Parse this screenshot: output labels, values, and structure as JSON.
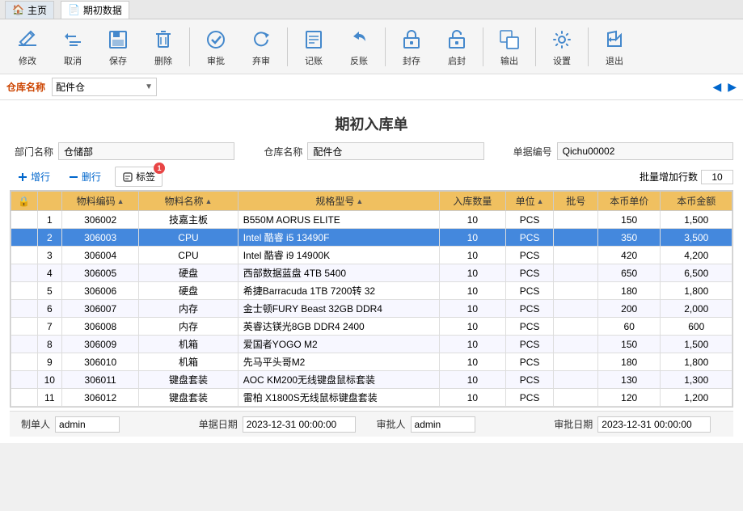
{
  "titleBar": {
    "homeTab": "主页",
    "activeTab": "期初数据"
  },
  "toolbar": {
    "buttons": [
      {
        "id": "edit",
        "label": "修改",
        "icon": "✏️"
      },
      {
        "id": "cancel",
        "label": "取消",
        "icon": "↩️"
      },
      {
        "id": "save",
        "label": "保存",
        "icon": "💾"
      },
      {
        "id": "delete",
        "label": "删除",
        "icon": "🗑️"
      },
      {
        "id": "approve",
        "label": "审批",
        "icon": "✅"
      },
      {
        "id": "abandon",
        "label": "弃审",
        "icon": "🔙"
      },
      {
        "id": "account",
        "label": "记账",
        "icon": "📒"
      },
      {
        "id": "reversal",
        "label": "反账",
        "icon": "🔄"
      },
      {
        "id": "seal",
        "label": "封存",
        "icon": "📦"
      },
      {
        "id": "unseal",
        "label": "启封",
        "icon": "📬"
      },
      {
        "id": "export",
        "label": "输出",
        "icon": "📤"
      },
      {
        "id": "settings",
        "label": "设置",
        "icon": "⚙️"
      },
      {
        "id": "exit",
        "label": "退出",
        "icon": "🚪"
      }
    ]
  },
  "warehouseBar": {
    "label": "仓库名称",
    "value": "配件仓"
  },
  "pageTitle": "期初入库单",
  "formFields": {
    "deptLabel": "部门名称",
    "deptValue": "仓储部",
    "warehouseLabel": "仓库名称",
    "warehouseValue": "配件仓",
    "docLabel": "单据编号",
    "docValue": "Qichu00002"
  },
  "actionBar": {
    "addLabel": "增行",
    "deleteLabel": "删行",
    "tagLabel": "标签",
    "tagBadge": "1",
    "batchLabel": "批量增加行数",
    "batchValue": "10"
  },
  "tableHeaders": [
    {
      "id": "lock",
      "label": ""
    },
    {
      "id": "num",
      "label": ""
    },
    {
      "id": "code",
      "label": "物料编码"
    },
    {
      "id": "name",
      "label": "物料名称"
    },
    {
      "id": "spec",
      "label": "规格型号"
    },
    {
      "id": "qty",
      "label": "入库数量"
    },
    {
      "id": "unit",
      "label": "单位"
    },
    {
      "id": "batch",
      "label": "批号"
    },
    {
      "id": "price",
      "label": "本币单价"
    },
    {
      "id": "amount",
      "label": "本币金额"
    }
  ],
  "tableRows": [
    {
      "num": 1,
      "code": "306002",
      "name": "技嘉主板",
      "spec": "B550M AORUS ELITE",
      "qty": 10,
      "unit": "PCS",
      "batch": "",
      "price": 150,
      "amount": "1,500",
      "selected": false
    },
    {
      "num": 2,
      "code": "306003",
      "name": "CPU",
      "spec": "Intel 酷睿 i5 13490F",
      "qty": 10,
      "unit": "PCS",
      "batch": "",
      "price": 350,
      "amount": "3,500",
      "selected": true
    },
    {
      "num": 3,
      "code": "306004",
      "name": "CPU",
      "spec": "Intel 酷睿 i9 14900K",
      "qty": 10,
      "unit": "PCS",
      "batch": "",
      "price": 420,
      "amount": "4,200",
      "selected": false
    },
    {
      "num": 4,
      "code": "306005",
      "name": "硬盘",
      "spec": "西部数据蓝盘 4TB 5400",
      "qty": 10,
      "unit": "PCS",
      "batch": "",
      "price": 650,
      "amount": "6,500",
      "selected": false
    },
    {
      "num": 5,
      "code": "306006",
      "name": "硬盘",
      "spec": "希捷Barracuda 1TB 7200转 32",
      "qty": 10,
      "unit": "PCS",
      "batch": "",
      "price": 180,
      "amount": "1,800",
      "selected": false
    },
    {
      "num": 6,
      "code": "306007",
      "name": "内存",
      "spec": "金士顿FURY Beast 32GB DDR4",
      "qty": 10,
      "unit": "PCS",
      "batch": "",
      "price": 200,
      "amount": "2,000",
      "selected": false
    },
    {
      "num": 7,
      "code": "306008",
      "name": "内存",
      "spec": "英睿达镁光8GB DDR4 2400",
      "qty": 10,
      "unit": "PCS",
      "batch": "",
      "price": 60,
      "amount": "600",
      "selected": false
    },
    {
      "num": 8,
      "code": "306009",
      "name": "机箱",
      "spec": "爱国者YOGO M2",
      "qty": 10,
      "unit": "PCS",
      "batch": "",
      "price": 150,
      "amount": "1,500",
      "selected": false
    },
    {
      "num": 9,
      "code": "306010",
      "name": "机箱",
      "spec": "先马平头哥M2",
      "qty": 10,
      "unit": "PCS",
      "batch": "",
      "price": 180,
      "amount": "1,800",
      "selected": false
    },
    {
      "num": 10,
      "code": "306011",
      "name": "键盘套装",
      "spec": "AOC KM200无线键盘鼠标套装",
      "qty": 10,
      "unit": "PCS",
      "batch": "",
      "price": 130,
      "amount": "1,300",
      "selected": false
    },
    {
      "num": 11,
      "code": "306012",
      "name": "键盘套装",
      "spec": "雷柏 X1800S无线鼠标键盘套装",
      "qty": 10,
      "unit": "PCS",
      "batch": "",
      "price": 120,
      "amount": "1,200",
      "selected": false
    }
  ],
  "footer": {
    "creatorLabel": "制单人",
    "creatorValue": "admin",
    "docDateLabel": "单据日期",
    "docDateValue": "2023-12-31 00:00:00",
    "approverLabel": "审批人",
    "approverValue": "admin",
    "approveDateLabel": "审批日期",
    "approveDateValue": "2023-12-31 00:00:00"
  }
}
